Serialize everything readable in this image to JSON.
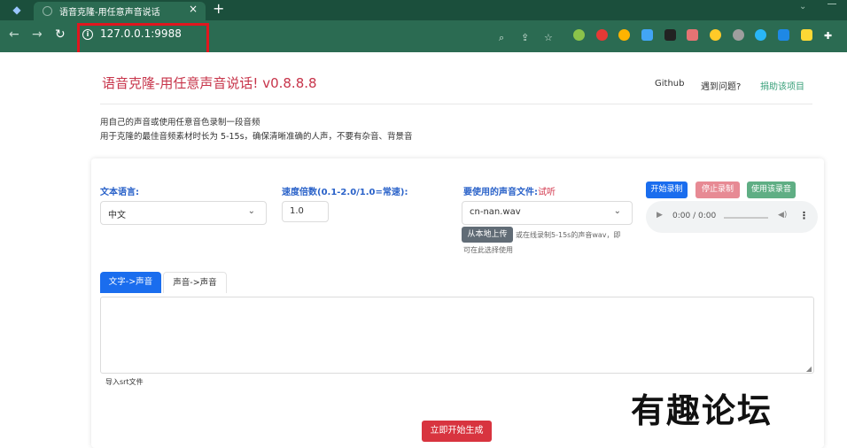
{
  "browser": {
    "tab_title": "语音克隆-用任意声音说话",
    "tab_close": "×",
    "new_tab": "+",
    "url": "127.0.0.1:9988"
  },
  "header": {
    "title": "语音克隆-用任意声音说话! v0.8.8.8",
    "links": [
      "Github",
      "遇到问题?",
      "捐助该项目"
    ]
  },
  "intro": {
    "line1": "用自己的声音或使用任意音色录制一段音频",
    "line2": "用于克隆的最佳音频素材时长为 5-15s，确保清晰准确的人声，不要有杂音、背景音"
  },
  "form": {
    "language_label": "文本语言:",
    "language_value": "中文",
    "speed_label": "速度倍数(0.1-2.0/1.0=常速):",
    "speed_value": "1.0",
    "voice_label": "要使用的声音文件:",
    "voice_sub": "试听",
    "voice_value": "cn-nan.wav",
    "upload_label": "从本地上传",
    "upload_hint_1": "或在线录制5-15s的声音wav，即",
    "upload_hint_2": "可在此选择使用"
  },
  "recorder": {
    "start": "开始录制",
    "stop": "停止录制",
    "use": "使用该录音",
    "time": "0:00 / 0:00"
  },
  "tabs": [
    "文字->声音",
    "声音->声音"
  ],
  "import_label": "导入srt文件",
  "generate": "立即开始生成",
  "watermark": "有趣论坛",
  "colors": {
    "browser_frame": "#2b6b52",
    "title_red": "#c7344a",
    "label_blue": "#2a62c9",
    "primary_blue": "#1a6dee",
    "stop_pink": "#e78a94",
    "use_green": "#5fae84",
    "generate_red": "#d8343f"
  }
}
